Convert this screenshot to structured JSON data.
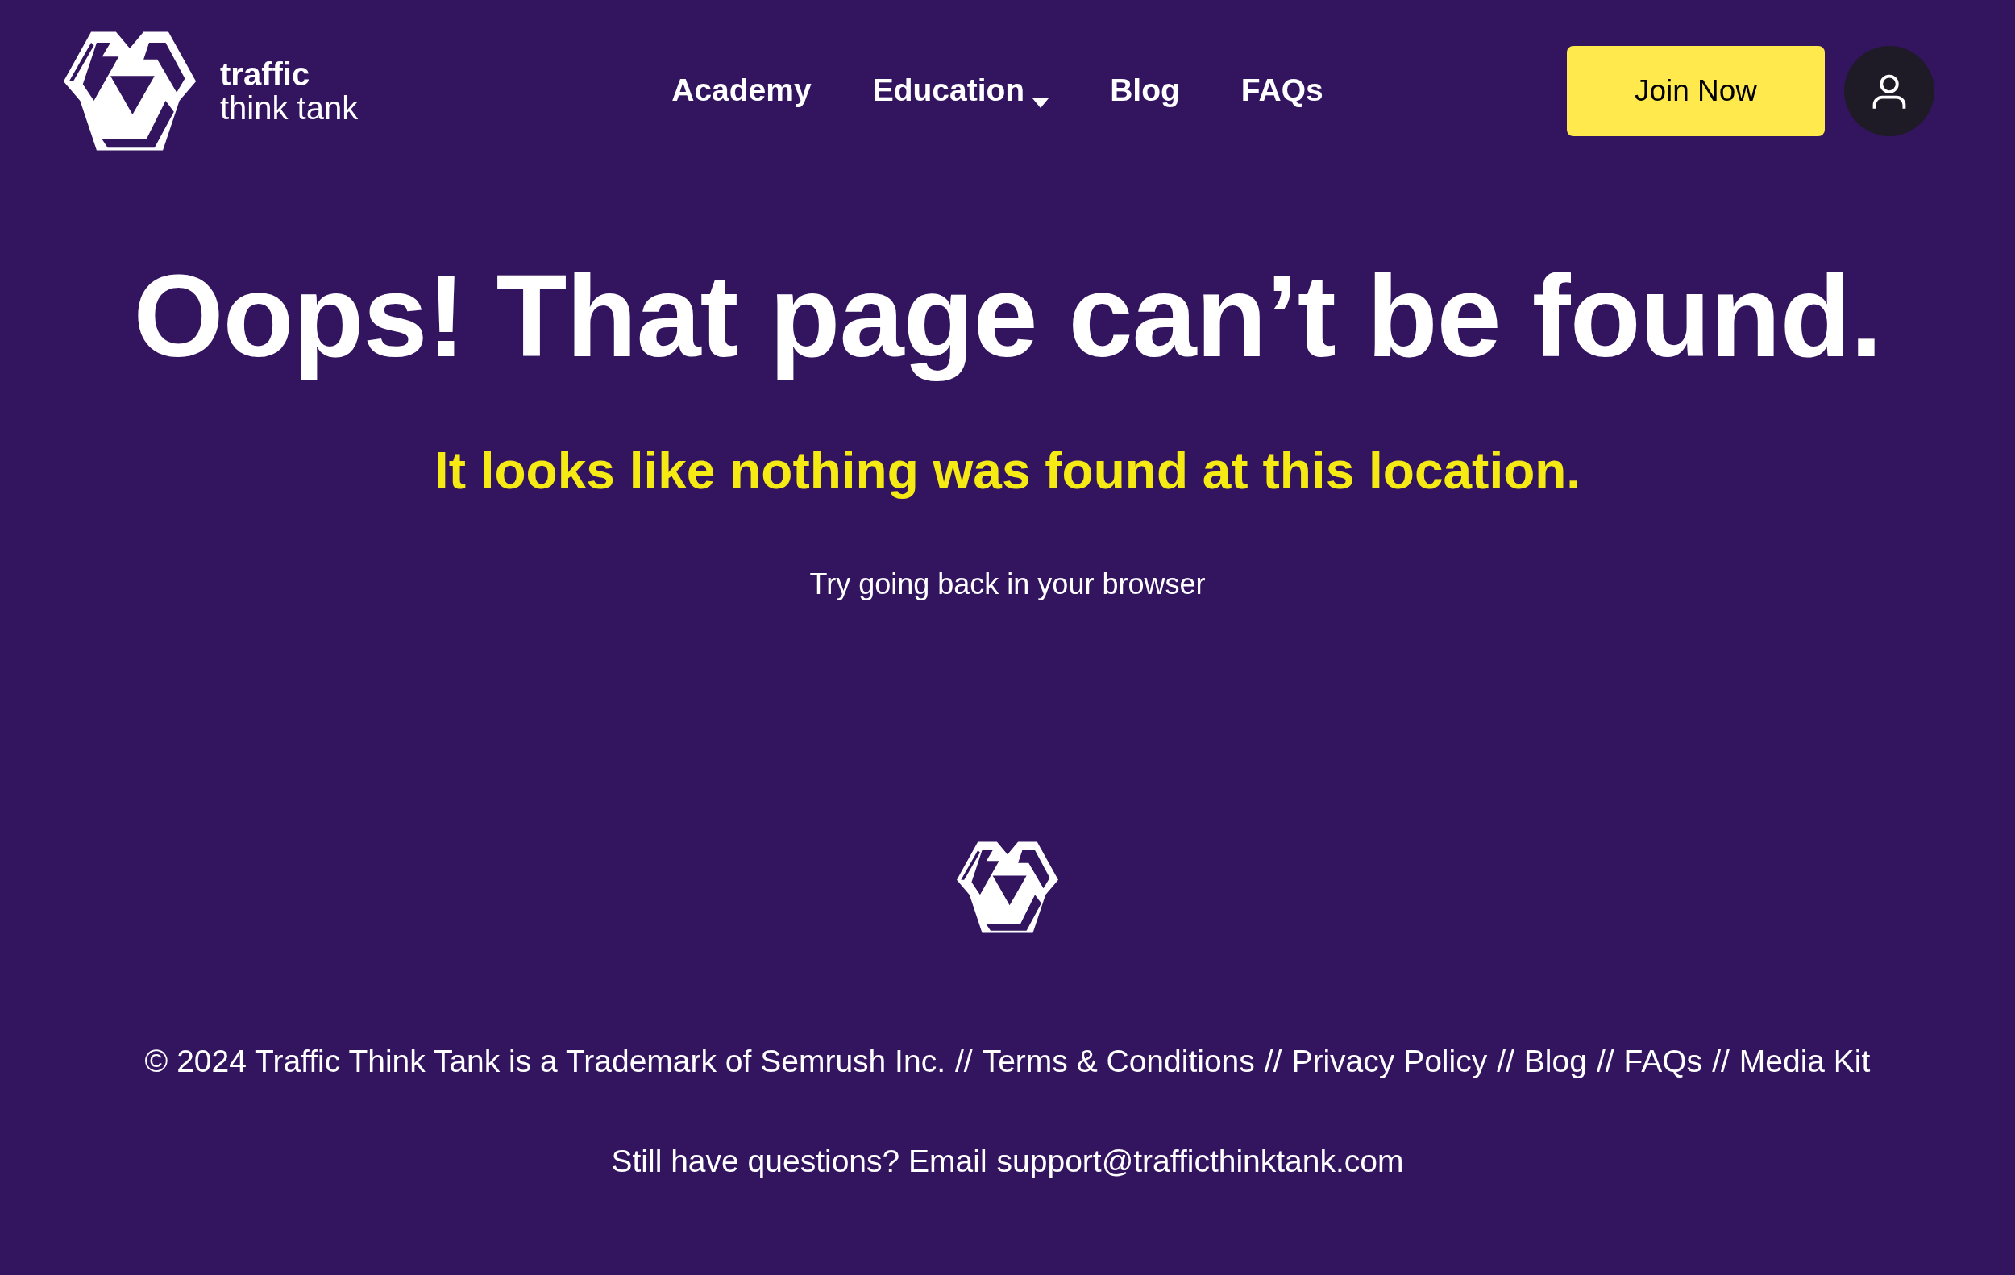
{
  "header": {
    "logo": {
      "line_1": "traffic",
      "line_2": "think tank"
    },
    "nav": [
      {
        "label": "Academy",
        "kind": "link"
      },
      {
        "label": "Education",
        "kind": "dropdown"
      },
      {
        "label": "Blog",
        "kind": "link"
      },
      {
        "label": "FAQs",
        "kind": "link"
      }
    ],
    "join_button": "Join Now"
  },
  "main": {
    "title": "Oops! That page can’t be found.",
    "subtitle": "It looks like nothing was found at this location.",
    "hint": "Try going back in your browser"
  },
  "footer": {
    "copyright": "© 2024 Traffic Think Tank is a Trademark of Semrush Inc.",
    "separator": "//",
    "links": [
      "Terms & Conditions",
      "Privacy Policy",
      "Blog",
      "FAQs",
      "Media Kit"
    ],
    "contact_text": "Still have questions? Email",
    "contact_email": "support@trafficthinktank.com"
  }
}
